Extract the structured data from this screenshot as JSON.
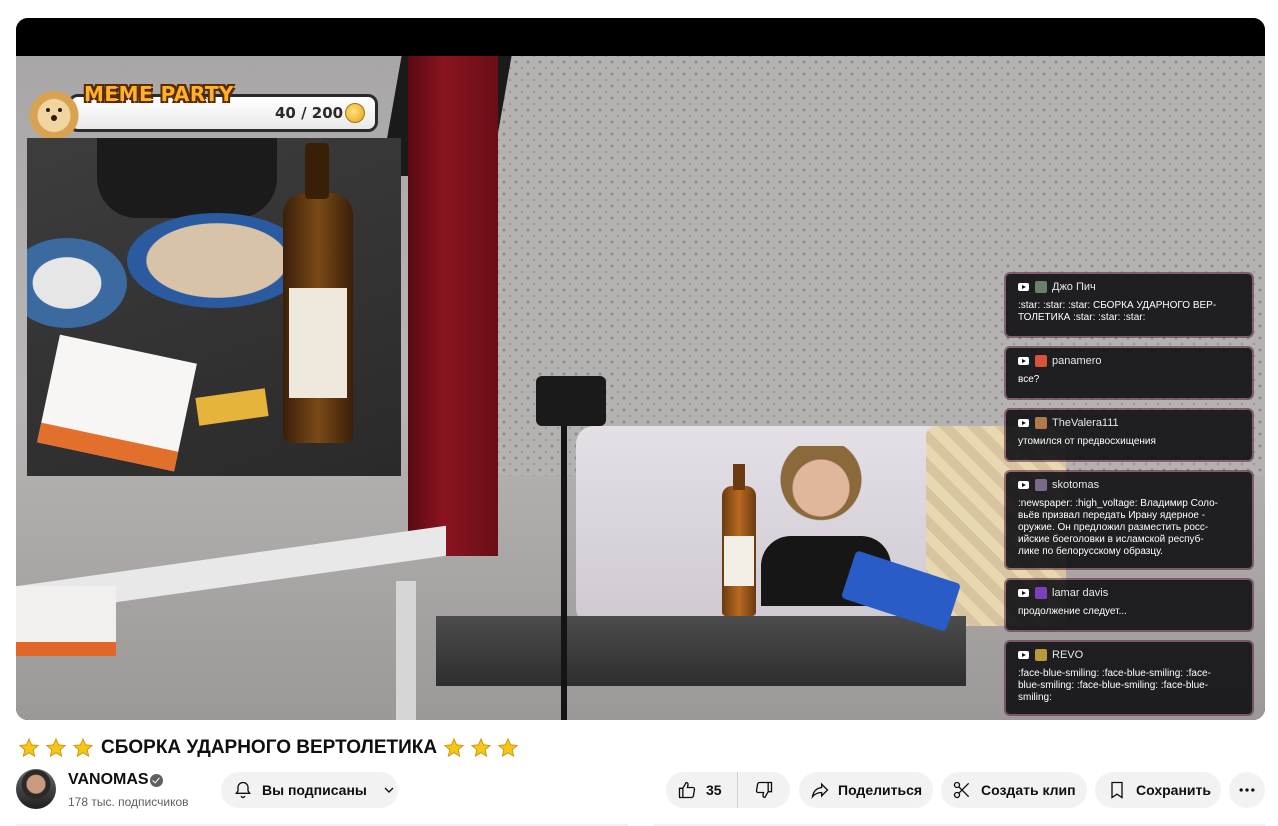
{
  "overlay": {
    "meme_title": "MEME PARTY",
    "meme_count": "40 / 200"
  },
  "chat": [
    {
      "name": "Джо Пич",
      "avatar_color": "#6b7f6a",
      "text": ":star: :star: :star: СБОРКА УДАРНОГО ВЕР-\nТОЛЕТИКА :star: :star: :star:"
    },
    {
      "name": "panamero",
      "avatar_color": "#d9533b",
      "text": "все?"
    },
    {
      "name": "TheValera111",
      "avatar_color": "#b07a4a",
      "text": "утомился от предвосхищения"
    },
    {
      "name": "skotomas",
      "avatar_color": "#7a6a8a",
      "text": ":newspaper: :high_voltage: Владимир Соло-\nвьёв призвал передать Ирану ядерное -\nоружие. Он предложил разместить росс-\nийские боеголовки в исламской респуб-\nлике по белорусскому образцу."
    },
    {
      "name": "lamar davis",
      "avatar_color": "#7b3fb8",
      "text": "продолжение следует..."
    },
    {
      "name": "REVO",
      "avatar_color": "#b89a3a",
      "text": ":face-blue-smiling: :face-blue-smiling: :face-\nblue-smiling: :face-blue-smiling: :face-blue-\nsmiling:"
    }
  ],
  "video": {
    "title": "СБОРКА УДАРНОГО ВЕРТОЛЕТИКА"
  },
  "channel": {
    "name": "VANOMAS",
    "subscribers": "178 тыс. подписчиков"
  },
  "actions": {
    "subscribe_label": "Вы подписаны",
    "like_count": "35",
    "share_label": "Поделиться",
    "clip_label": "Создать клип",
    "save_label": "Сохранить"
  },
  "colors": {
    "star": "#f5c518",
    "pill_bg": "#f2f2f2",
    "chat_bg": "#121216"
  }
}
